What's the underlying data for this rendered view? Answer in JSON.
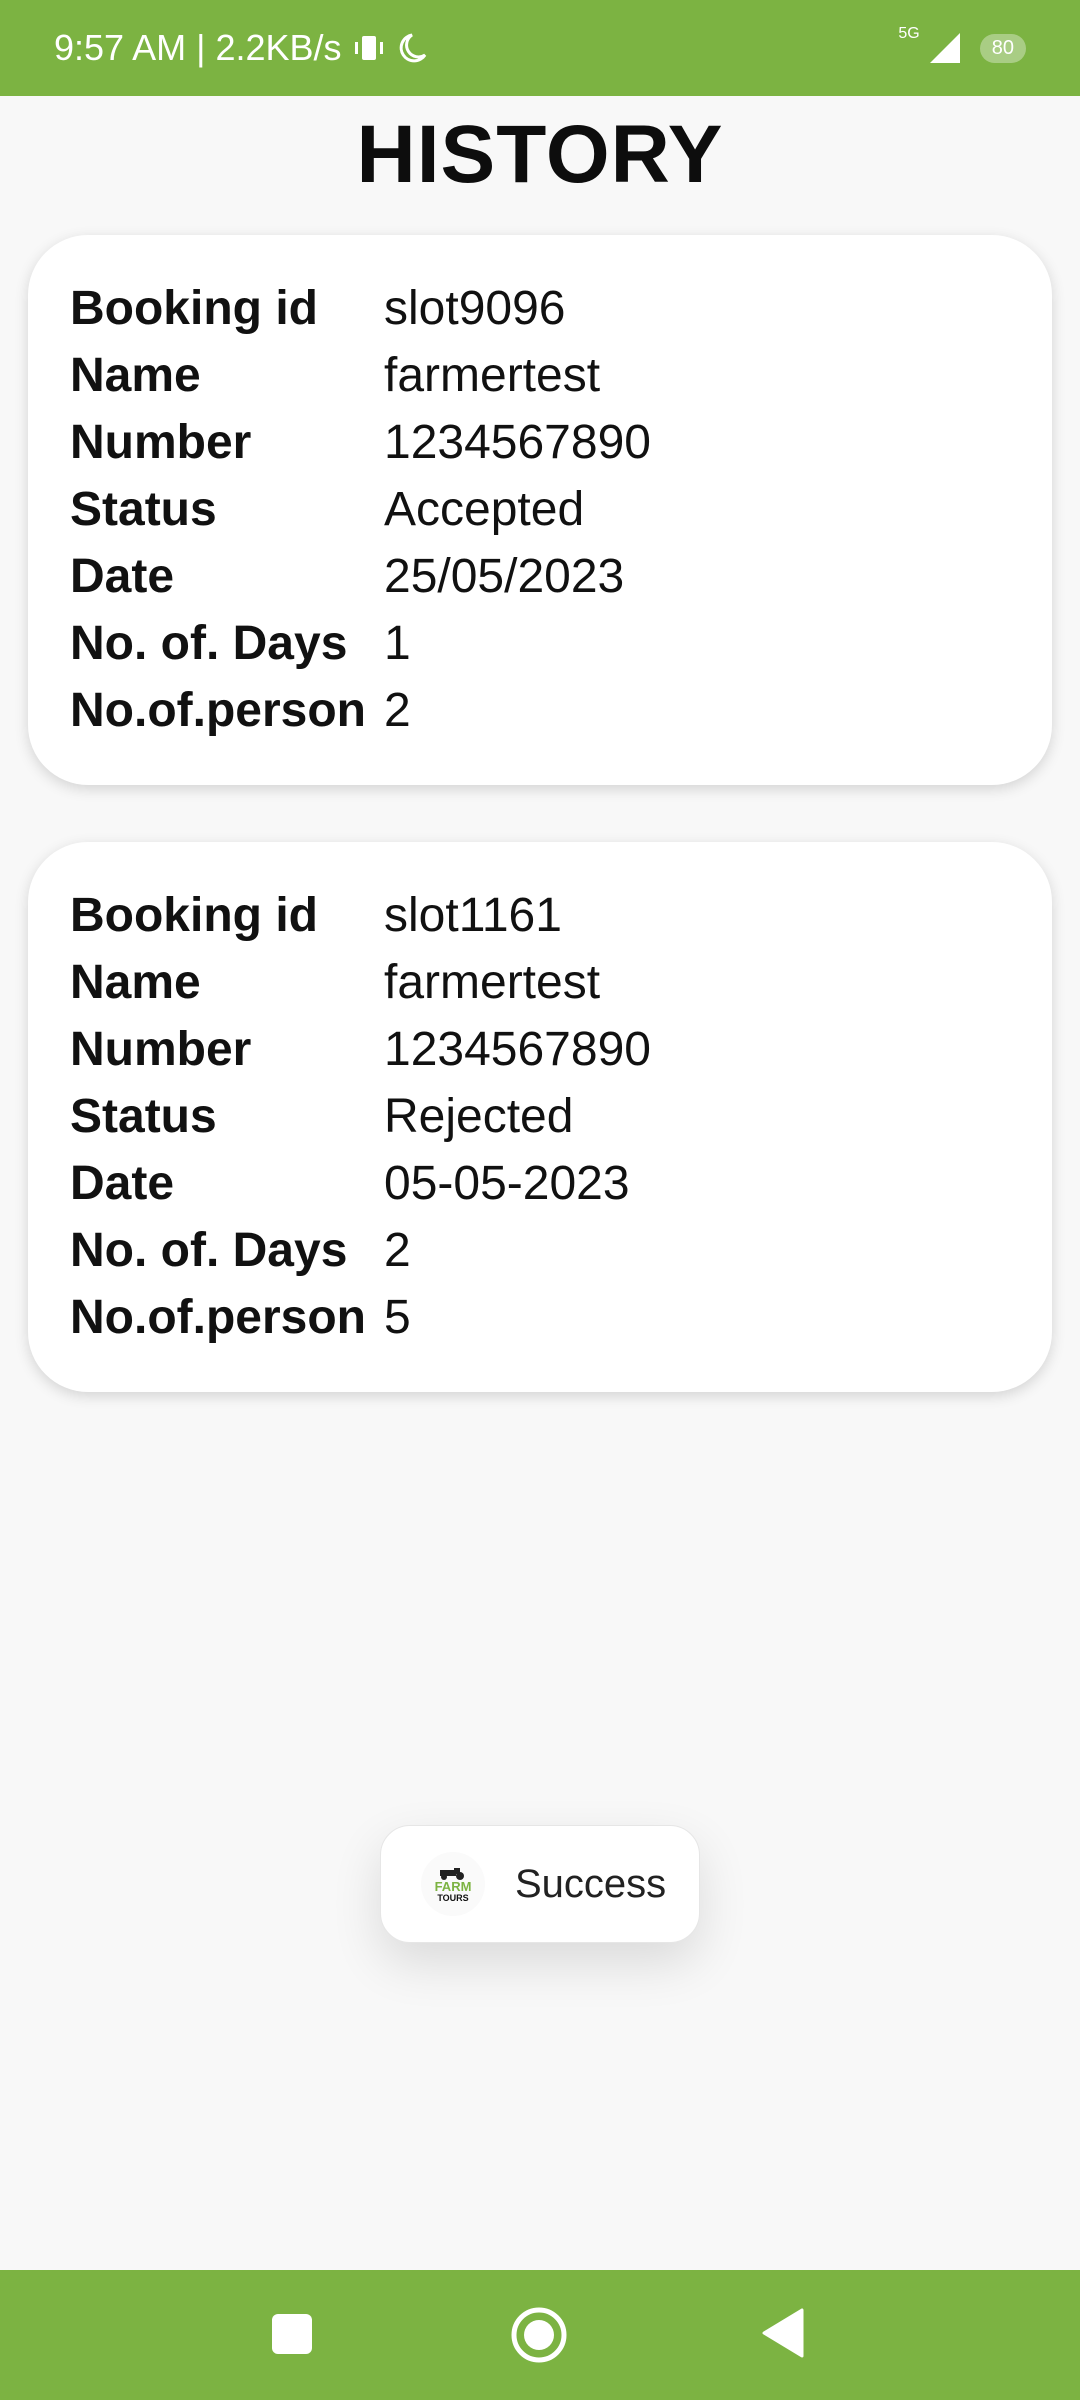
{
  "status_bar": {
    "time_speed": "9:57 AM | 2.2KB/s",
    "network": "5G",
    "battery": "80"
  },
  "page": {
    "title": "HISTORY"
  },
  "bookings": [
    {
      "booking_id_label": "Booking id",
      "booking_id": "slot9096",
      "name_label": "Name",
      "name": "farmertest",
      "number_label": "Number",
      "number": "1234567890",
      "status_label": "Status",
      "status": "Accepted",
      "date_label": "Date",
      "date": "25/05/2023",
      "days_label": "No. of. Days",
      "days": "1",
      "persons_label": "No.of.person",
      "persons": "2"
    },
    {
      "booking_id_label": "Booking id",
      "booking_id": "slot1161",
      "name_label": "Name",
      "name": "farmertest",
      "number_label": "Number",
      "number": "1234567890",
      "status_label": "Status",
      "status": "Rejected",
      "date_label": "Date",
      "date": "05-05-2023",
      "days_label": "No. of. Days",
      "days": "2",
      "persons_label": "No.of.person",
      "persons": "5"
    }
  ],
  "toast": {
    "message": "Success",
    "logo_text_top": "FARM",
    "logo_text_bottom": "TOURS"
  },
  "colors": {
    "accent": "#7cb342",
    "background": "#f8f8f8",
    "card": "#ffffff"
  },
  "nav_bar": {
    "icons": [
      "square-recents-icon",
      "circle-home-icon",
      "triangle-back-icon"
    ]
  }
}
